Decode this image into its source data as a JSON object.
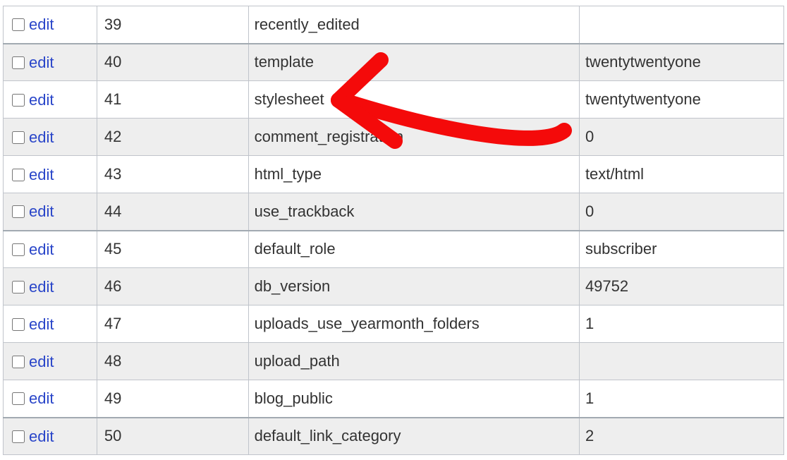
{
  "edit_label": "edit",
  "rows": [
    {
      "id": "39",
      "name": "recently_edited",
      "value": "",
      "shade": "even",
      "group": false
    },
    {
      "id": "40",
      "name": "template",
      "value": "twentytwentyone",
      "shade": "odd",
      "group": true
    },
    {
      "id": "41",
      "name": "stylesheet",
      "value": "twentytwentyone",
      "shade": "even",
      "group": false
    },
    {
      "id": "42",
      "name": "comment_registration",
      "value": "0",
      "shade": "odd",
      "group": false
    },
    {
      "id": "43",
      "name": "html_type",
      "value": "text/html",
      "shade": "even",
      "group": false
    },
    {
      "id": "44",
      "name": "use_trackback",
      "value": "0",
      "shade": "odd",
      "group": false
    },
    {
      "id": "45",
      "name": "default_role",
      "value": "subscriber",
      "shade": "even",
      "group": true
    },
    {
      "id": "46",
      "name": "db_version",
      "value": "49752",
      "shade": "odd",
      "group": false
    },
    {
      "id": "47",
      "name": "uploads_use_yearmonth_folders",
      "value": "1",
      "shade": "even",
      "group": false
    },
    {
      "id": "48",
      "name": "upload_path",
      "value": "",
      "shade": "odd",
      "group": false
    },
    {
      "id": "49",
      "name": "blog_public",
      "value": "1",
      "shade": "even",
      "group": false
    },
    {
      "id": "50",
      "name": "default_link_category",
      "value": "2",
      "shade": "odd",
      "group": true
    }
  ],
  "annotation": {
    "style": "red-curved-arrow",
    "target_row_name": "stylesheet"
  }
}
